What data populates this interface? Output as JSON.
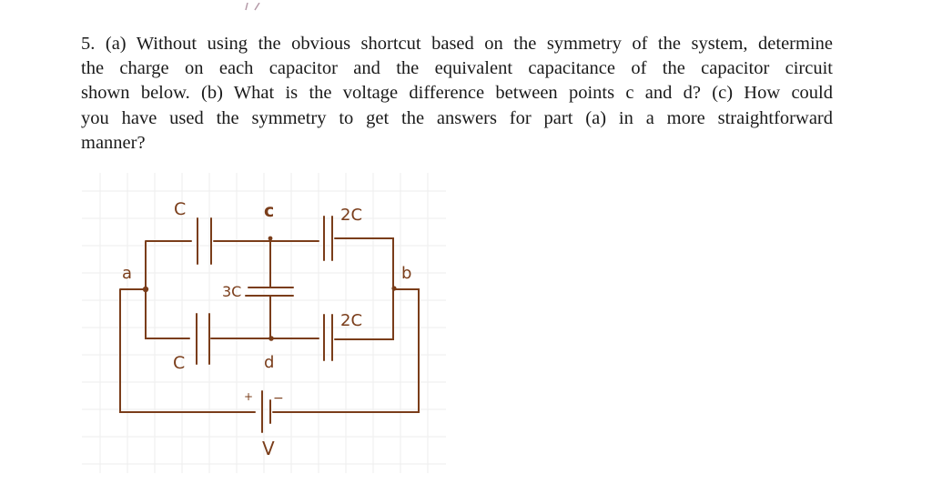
{
  "problem": {
    "number": "5.",
    "lines": [
      "5. (a) Without using the obvious shortcut based on the symmetry of the system, determine",
      "the charge on each capacitor and the equivalent capacitance of the capacitor circuit",
      "shown below. (b) What is the voltage difference between points c and d? (c) How could",
      "you have used the symmetry to get the answers for part (a) in a more straightforward",
      "manner?"
    ]
  },
  "circuit": {
    "ink_color": "#7a3d1a",
    "grid_color": "#ececec",
    "labels": {
      "top_left_cap": "C",
      "top_node": "c",
      "top_right_cap": "2C",
      "left_node": "a",
      "right_node": "b",
      "middle_cap": "3C",
      "bottom_right_cap": "2C",
      "bottom_left_cap": "C",
      "bottom_node": "d",
      "battery_plus": "+",
      "battery_minus": "−",
      "battery_label": "V"
    }
  }
}
